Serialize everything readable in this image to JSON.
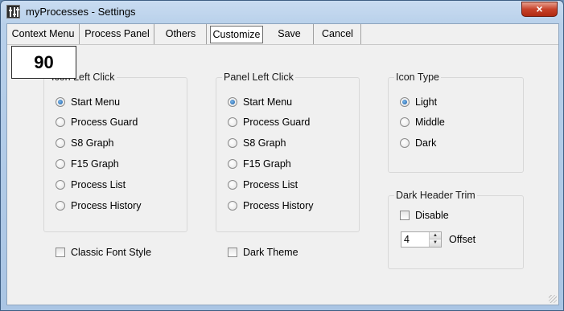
{
  "window": {
    "title": "myProcesses - Settings",
    "close_label": "×"
  },
  "tabs": [
    {
      "label": "Context Menu"
    },
    {
      "label": "Process Panel"
    },
    {
      "label": "Others"
    },
    {
      "label": "Customize",
      "active": true
    },
    {
      "label": "Save"
    },
    {
      "label": "Cancel"
    }
  ],
  "fps_counter": "90",
  "icon_left_click": {
    "title": "Icon Left Click",
    "options": [
      "Start Menu",
      "Process Guard",
      "S8 Graph",
      "F15 Graph",
      "Process List",
      "Process History"
    ],
    "selected": "Start Menu"
  },
  "panel_left_click": {
    "title": "Panel Left Click",
    "options": [
      "Start Menu",
      "Process Guard",
      "S8 Graph",
      "F15 Graph",
      "Process List",
      "Process History"
    ],
    "selected": "Start Menu"
  },
  "icon_type": {
    "title": "Icon Type",
    "options": [
      "Light",
      "Middle",
      "Dark"
    ],
    "selected": "Light"
  },
  "dark_header_trim": {
    "title": "Dark Header Trim",
    "disable_label": "Disable",
    "disable_checked": false,
    "offset_value": "4",
    "offset_label": "Offset"
  },
  "classic_font_style": {
    "label": "Classic Font Style",
    "checked": false
  },
  "dark_theme": {
    "label": "Dark Theme",
    "checked": false
  },
  "colors": {
    "accent": "#1a5ea8",
    "close": "#c7422a"
  }
}
